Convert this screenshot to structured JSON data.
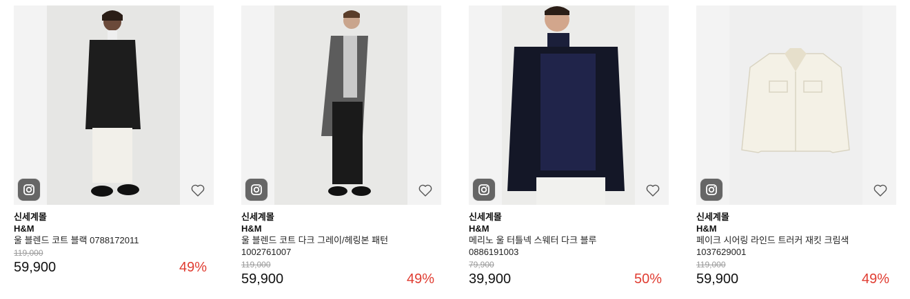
{
  "products": [
    {
      "mall": "신세계몰",
      "brand": "H&M",
      "name": "울 블렌드 코트 블랙 0788172011",
      "code": "",
      "original_price": "119,000",
      "price": "59,900",
      "discount": "49%",
      "image_icon": "coat-black-model-image"
    },
    {
      "mall": "신세계몰",
      "brand": "H&M",
      "name": "울 블렌드 코트 다크 그레이/헤링본 패턴",
      "code": "1002761007",
      "original_price": "119,000",
      "price": "59,900",
      "discount": "49%",
      "image_icon": "coat-grey-model-image"
    },
    {
      "mall": "신세계몰",
      "brand": "H&M",
      "name": "메리노 울 터틀넥 스웨터 다크 블루",
      "code": "0886191003",
      "original_price": "79,900",
      "price": "39,900",
      "discount": "50%",
      "image_icon": "jacket-navy-model-image"
    },
    {
      "mall": "신세계몰",
      "brand": "H&M",
      "name": "페이크 시어링 라인드 트러커 재킷 크림색",
      "code": "1037629001",
      "original_price": "119,000",
      "price": "59,900",
      "discount": "49%",
      "image_icon": "jacket-cream-product-image"
    }
  ],
  "colors": {
    "discount": "#e03c31",
    "strike_price": "#999999",
    "instagram_button": "#666666",
    "thumb_bg": "#f3f3f3"
  },
  "icons": {
    "instagram": "instagram-icon",
    "wishlist": "heart-icon"
  }
}
